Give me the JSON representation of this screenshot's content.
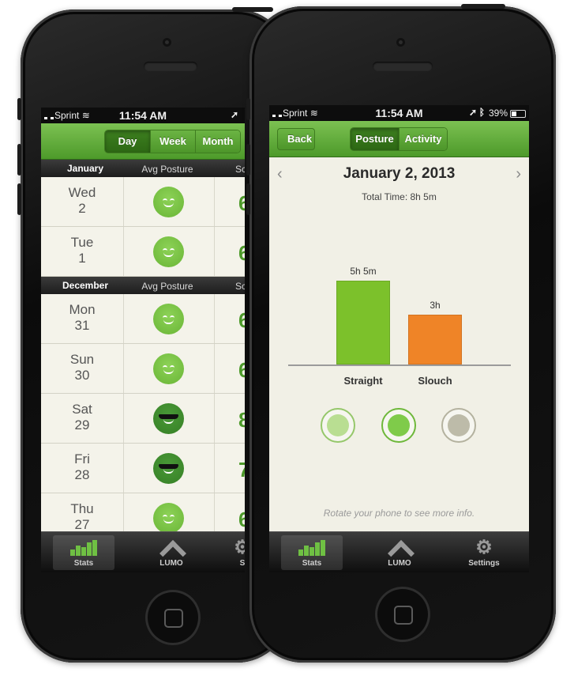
{
  "left_phone": {
    "status": {
      "carrier": "Sprint",
      "time": "11:54 AM"
    },
    "segments": [
      {
        "label": "Day",
        "active": true
      },
      {
        "label": "Week",
        "active": false
      },
      {
        "label": "Month",
        "active": false
      }
    ],
    "sections": [
      {
        "month": "January",
        "col_header": "Avg Posture",
        "col2": "Sc",
        "rows": [
          {
            "weekday": "Wed",
            "date": "2",
            "face": "happy",
            "score": "6"
          },
          {
            "weekday": "Tue",
            "date": "1",
            "face": "happy",
            "score": "6"
          }
        ]
      },
      {
        "month": "December",
        "col_header": "Avg Posture",
        "col2": "Sc",
        "rows": [
          {
            "weekday": "Mon",
            "date": "31",
            "face": "happy",
            "score": "6"
          },
          {
            "weekday": "Sun",
            "date": "30",
            "face": "happy",
            "score": "6"
          },
          {
            "weekday": "Sat",
            "date": "29",
            "face": "cool",
            "score": "8"
          },
          {
            "weekday": "Fri",
            "date": "28",
            "face": "cool",
            "score": "7"
          },
          {
            "weekday": "Thu",
            "date": "27",
            "face": "happy",
            "score": "6"
          }
        ]
      }
    ],
    "tabs": [
      {
        "label": "Stats",
        "icon": "bar-chart-icon",
        "active": true
      },
      {
        "label": "LUMO",
        "icon": "chevron-up-icon",
        "active": false
      },
      {
        "label": "S",
        "icon": "gear-icon",
        "active": false
      }
    ]
  },
  "right_phone": {
    "status": {
      "carrier": "Sprint",
      "time": "11:54 AM",
      "battery": "39%"
    },
    "back_label": "Back",
    "segments": [
      {
        "label": "Posture",
        "active": true
      },
      {
        "label": "Activity",
        "active": false
      }
    ],
    "date": "January 2, 2013",
    "prev_arrow": "‹",
    "next_arrow": "›",
    "total_time": "Total Time: 8h 5m",
    "chart_data": {
      "type": "bar",
      "categories": [
        "Straight",
        "Slouch"
      ],
      "values": [
        305,
        180
      ],
      "value_labels": [
        "5h 5m",
        "3h"
      ],
      "colors": [
        "#7cc12b",
        "#ef8427"
      ]
    },
    "faces": [
      {
        "icon": "smiley-light-icon",
        "ring": "#95c76a",
        "fill": "#b9de92"
      },
      {
        "icon": "smiley-active-icon",
        "ring": "#6eb83a",
        "fill": "#7fcb4a"
      },
      {
        "icon": "smiley-gray-icon",
        "ring": "#b4b29f",
        "fill": "#bdbba9"
      }
    ],
    "hint": "Rotate your phone to see more info.",
    "tabs": [
      {
        "label": "Stats",
        "icon": "bar-chart-icon",
        "active": true
      },
      {
        "label": "LUMO",
        "icon": "chevron-up-icon",
        "active": false
      },
      {
        "label": "Settings",
        "icon": "gear-icon",
        "active": false
      }
    ]
  }
}
